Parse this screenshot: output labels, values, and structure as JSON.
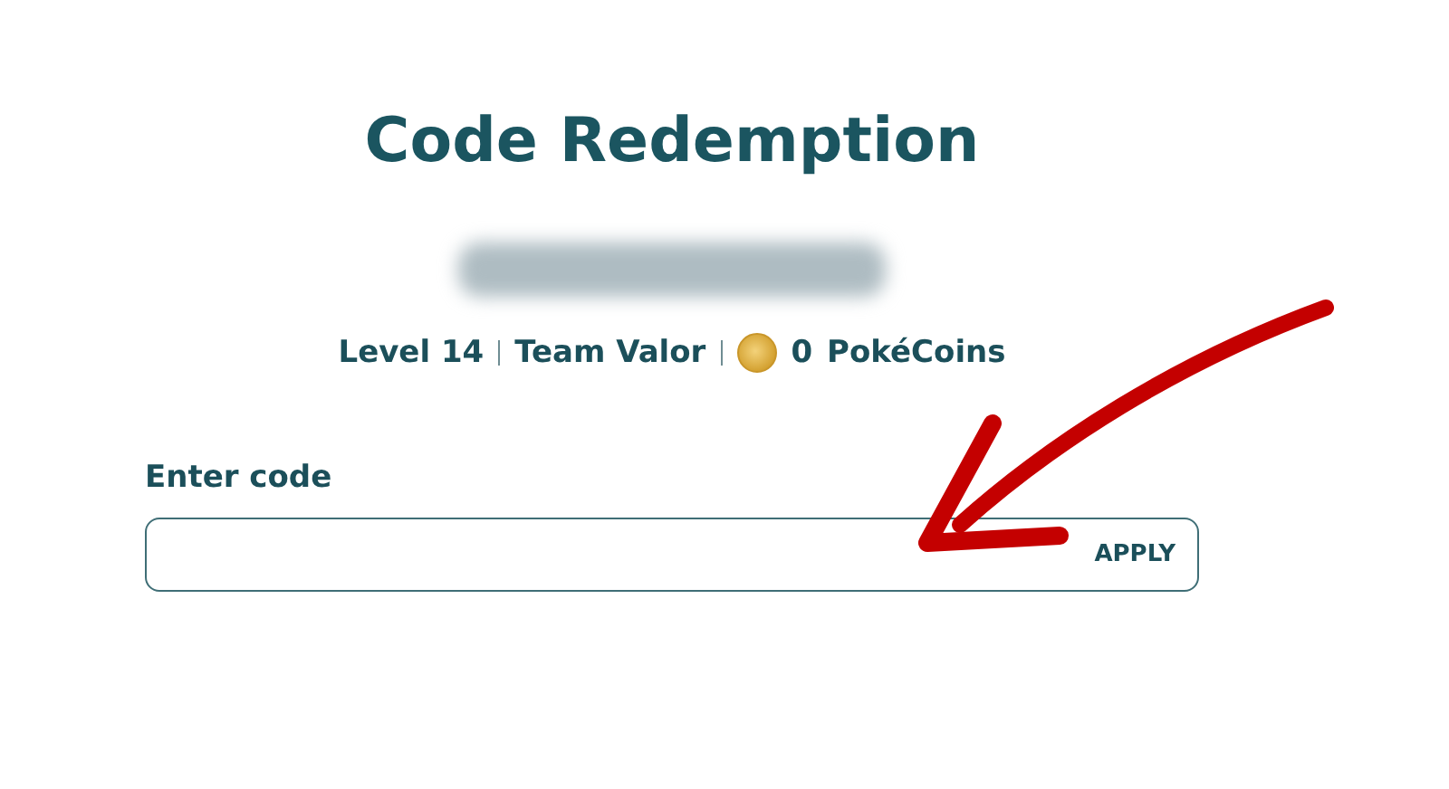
{
  "title": "Code Redemption",
  "stats": [
    {
      "kind": "text",
      "text": "Level 14"
    },
    {
      "kind": "text",
      "text": "Team Valor"
    },
    {
      "kind": "coins",
      "amount": "0",
      "text": "PokéCoins"
    }
  ],
  "code_form": {
    "label": "Enter code",
    "button": "APPLY"
  }
}
